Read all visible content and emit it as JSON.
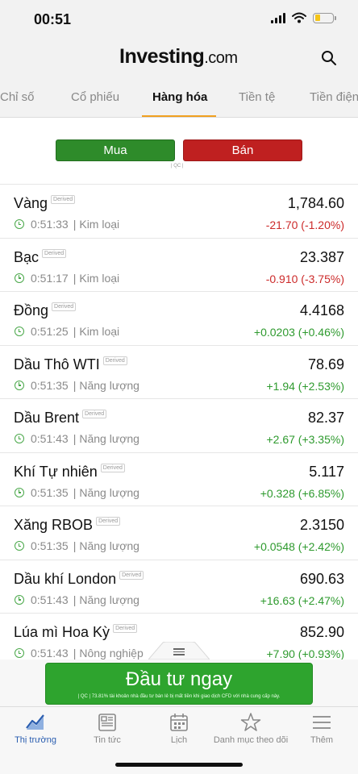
{
  "status_bar": {
    "time": "00:51"
  },
  "header": {
    "logo_main": "Investing",
    "logo_suffix": ".com"
  },
  "tabs": [
    {
      "label": "Chỉ số"
    },
    {
      "label": "Cổ phiếu"
    },
    {
      "label": "Hàng hóa"
    },
    {
      "label": "Tiền tệ"
    },
    {
      "label": "Tiền điện"
    }
  ],
  "trade": {
    "buy_label": "Mua",
    "sell_label": "Bán",
    "ad_mark": "| QC |"
  },
  "derived_tag": "Derived",
  "rows": [
    {
      "name": "Vàng",
      "time": "0:51:33",
      "category": "Kim loại",
      "price": "1,784.60",
      "change": "-21.70 (-1.20%)",
      "direction": "down"
    },
    {
      "name": "Bạc",
      "time": "0:51:17",
      "category": "Kim loại",
      "price": "23.387",
      "change": "-0.910 (-3.75%)",
      "direction": "down"
    },
    {
      "name": "Đồng",
      "time": "0:51:25",
      "category": "Kim loại",
      "price": "4.4168",
      "change": "+0.0203 (+0.46%)",
      "direction": "up"
    },
    {
      "name": "Dầu Thô WTI",
      "time": "0:51:35",
      "category": "Năng lượng",
      "price": "78.69",
      "change": "+1.94 (+2.53%)",
      "direction": "up"
    },
    {
      "name": "Dầu Brent",
      "time": "0:51:43",
      "category": "Năng lượng",
      "price": "82.37",
      "change": "+2.67 (+3.35%)",
      "direction": "up"
    },
    {
      "name": "Khí Tự nhiên",
      "time": "0:51:35",
      "category": "Năng lượng",
      "price": "5.117",
      "change": "+0.328 (+6.85%)",
      "direction": "up"
    },
    {
      "name": "Xăng RBOB",
      "time": "0:51:35",
      "category": "Năng lượng",
      "price": "2.3150",
      "change": "+0.0548 (+2.42%)",
      "direction": "up"
    },
    {
      "name": "Dầu khí London",
      "time": "0:51:43",
      "category": "Năng lượng",
      "price": "690.63",
      "change": "+16.63 (+2.47%)",
      "direction": "up"
    },
    {
      "name": "Lúa mì Hoa Kỳ",
      "time": "0:51:43",
      "category": "Nông nghiệp",
      "price": "852.90",
      "change": "+7.90 (+0.93%)",
      "direction": "up"
    }
  ],
  "ad": {
    "cta_label": "Đầu tư ngay",
    "disclaimer": "| QC | 73.81% tài khoản nhà đầu tư bán lẻ bị mất tiền khi giao dịch CFD với nhà cung cấp này."
  },
  "bottom_nav": [
    {
      "label": "Thị trường"
    },
    {
      "label": "Tin tức"
    },
    {
      "label": "Lịch"
    },
    {
      "label": "Danh mục theo dõi"
    },
    {
      "label": "Thêm"
    }
  ],
  "colors": {
    "buy": "#2e8b2a",
    "sell": "#bf2020",
    "positive": "#2e9a2e",
    "negative": "#cc2a2a",
    "active_tab_underline": "#f0a020",
    "active_nav": "#2a5db0"
  }
}
